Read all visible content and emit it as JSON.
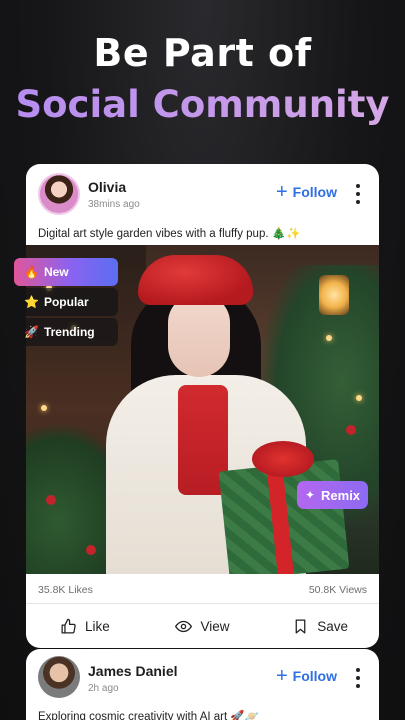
{
  "headline": {
    "line1": "Be Part of",
    "line2": "Social Community"
  },
  "post1": {
    "username": "Olivia",
    "timestamp": "38mins ago",
    "follow_label": "Follow",
    "caption": "Digital art style garden vibes with a fluffy pup. 🎄✨",
    "filters": [
      {
        "label": "New",
        "icon": "🔥",
        "active": true
      },
      {
        "label": "Popular",
        "icon": "⭐",
        "active": false
      },
      {
        "label": "Trending",
        "icon": "🚀",
        "active": false
      }
    ],
    "remix_label": "Remix",
    "likes": "35.8K Likes",
    "views": "50.8K Views",
    "actions": {
      "like": "Like",
      "view": "View",
      "save": "Save"
    }
  },
  "post2": {
    "username": "James Daniel",
    "timestamp": "2h ago",
    "follow_label": "Follow",
    "caption": "Exploring cosmic creativity with AI art 🚀🪐"
  },
  "colors": {
    "accent": "#2f6fe4",
    "gradient_start": "#e0569a",
    "gradient_end": "#5a6ef2",
    "remix": "#a868f0",
    "headline_purple": "#c79be8"
  },
  "icons": {
    "more": "more-vertical-icon",
    "like": "thumbs-up-icon",
    "view": "eye-icon",
    "save": "bookmark-icon",
    "remix": "sparkles-icon"
  }
}
